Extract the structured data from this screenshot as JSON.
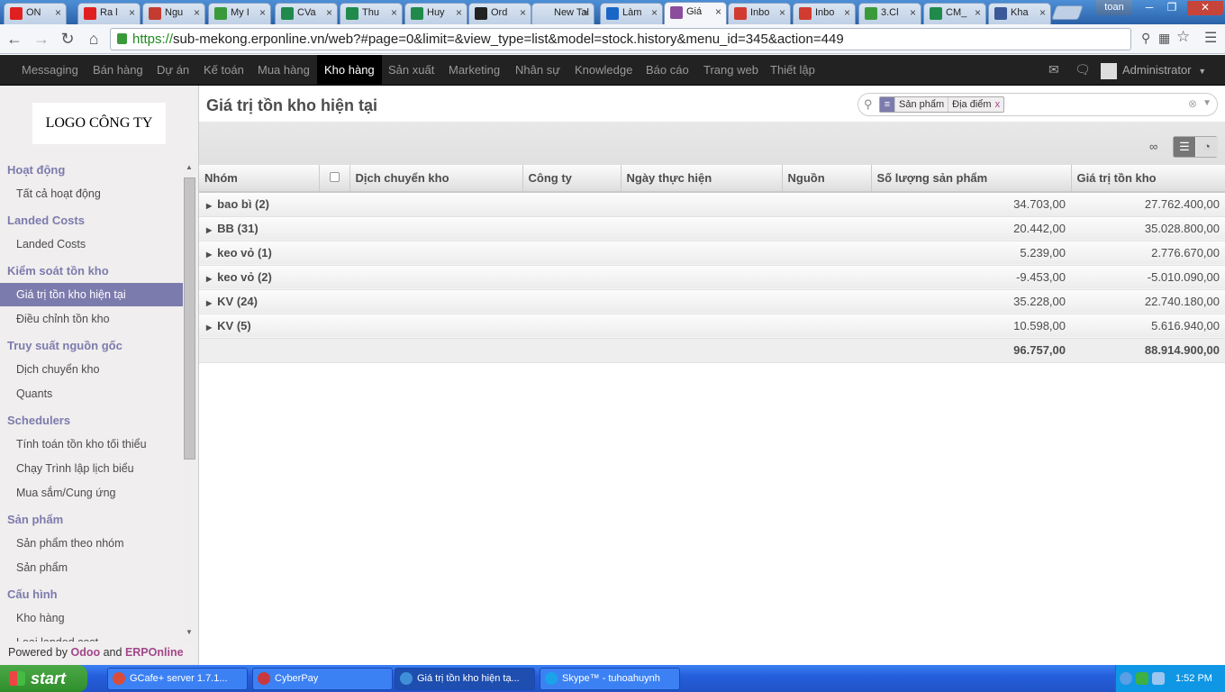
{
  "browser": {
    "tabs": [
      {
        "label": "ON",
        "color": "#e02020"
      },
      {
        "label": "Ra l",
        "color": "#e02020"
      },
      {
        "label": "Ngu",
        "color": "#c43b2f"
      },
      {
        "label": "My I",
        "color": "#3a9a3a"
      },
      {
        "label": "CVa",
        "color": "#1f8a4c"
      },
      {
        "label": "Thu",
        "color": "#1f8a4c"
      },
      {
        "label": "Huy",
        "color": "#1f8a4c"
      },
      {
        "label": "Ord",
        "color": "#222222"
      },
      {
        "label": "New Tal",
        "color": "#ffffff"
      },
      {
        "label": "Làm",
        "color": "#1a66c7"
      },
      {
        "label": "Giá",
        "color": "#8b4c9b"
      },
      {
        "label": "Inbo",
        "color": "#d13b30"
      },
      {
        "label": "Inbo",
        "color": "#d13b30"
      },
      {
        "label": "3.Cl",
        "color": "#3a9a3a"
      },
      {
        "label": "CM_",
        "color": "#1f8a4c"
      },
      {
        "label": "Kha",
        "color": "#3b5998"
      }
    ],
    "user": "toan",
    "url_scheme": "https://",
    "url_rest": "sub-mekong.erponline.vn/web?#page=0&limit=&view_type=list&model=stock.history&menu_id=345&action=449"
  },
  "topmenu": {
    "items": [
      "Messaging",
      "Bán hàng",
      "Dự án",
      "Kế toán",
      "Mua hàng",
      "Kho hàng",
      "Sản xuất",
      "Marketing",
      "Nhân sự",
      "Knowledge",
      "Báo cáo",
      "Trang web",
      "Thiết lập"
    ],
    "active_index": 5,
    "user": "Administrator"
  },
  "sidebar": {
    "logo": "LOGO CÔNG TY",
    "sections": [
      {
        "title": "Hoạt động",
        "items": [
          "Tất cả hoạt động"
        ]
      },
      {
        "title": "Landed Costs",
        "items": [
          "Landed Costs"
        ]
      },
      {
        "title": "Kiểm soát tồn kho",
        "items": [
          "Giá trị tồn kho hiện tại",
          "Điều chỉnh tồn kho"
        ]
      },
      {
        "title": "Truy suất nguồn gốc",
        "items": [
          "Dịch chuyển kho",
          "Quants"
        ]
      },
      {
        "title": "Schedulers",
        "items": [
          "Tính toán tồn kho tối thiểu",
          "Chạy Trình lập lịch biểu",
          "Mua sắm/Cung ứng"
        ]
      },
      {
        "title": "Sản phẩm",
        "items": [
          "Sản phẩm theo nhóm",
          "Sản phẩm"
        ]
      },
      {
        "title": "Cấu hình",
        "items": [
          "Kho hàng",
          "Loại landed cost"
        ]
      }
    ],
    "active_item": "Giá trị tồn kho hiện tại",
    "powered_prefix": "Powered by ",
    "powered_odoo": "Odoo",
    "powered_and": " and ",
    "powered_erp": "ERPOnline"
  },
  "main": {
    "title": "Giá trị tồn kho hiện tại",
    "search": {
      "facet_values": [
        "Sản phẩm",
        "Địa điểm"
      ],
      "facet_remove": "x"
    },
    "limit_label": "∞",
    "columns": [
      "Nhóm",
      "Dịch chuyển kho",
      "Công ty",
      "Ngày thực hiện",
      "Nguồn",
      "Số lượng sản phẩm",
      "Giá trị tồn kho"
    ],
    "groups": [
      {
        "name": "bao bì (2)",
        "qty": "34.703,00",
        "value": "27.762.400,00"
      },
      {
        "name": "BB (31)",
        "qty": "20.442,00",
        "value": "35.028.800,00"
      },
      {
        "name": "keo vỏ (1)",
        "qty": "5.239,00",
        "value": "2.776.670,00"
      },
      {
        "name": "keo vỏ (2)",
        "qty": "-9.453,00",
        "value": "-5.010.090,00"
      },
      {
        "name": "KV (24)",
        "qty": "35.228,00",
        "value": "22.740.180,00"
      },
      {
        "name": "KV (5)",
        "qty": "10.598,00",
        "value": "5.616.940,00"
      }
    ],
    "total_qty": "96.757,00",
    "total_value": "88.914.900,00"
  },
  "taskbar": {
    "start": "start",
    "tasks": [
      "GCafe+ server 1.7.1...",
      "CyberPay",
      "Giá trị tồn kho hiện tạ...",
      "Skype™ - tuhoahuynh"
    ],
    "active_task": 2,
    "clock": "1:52 PM"
  }
}
